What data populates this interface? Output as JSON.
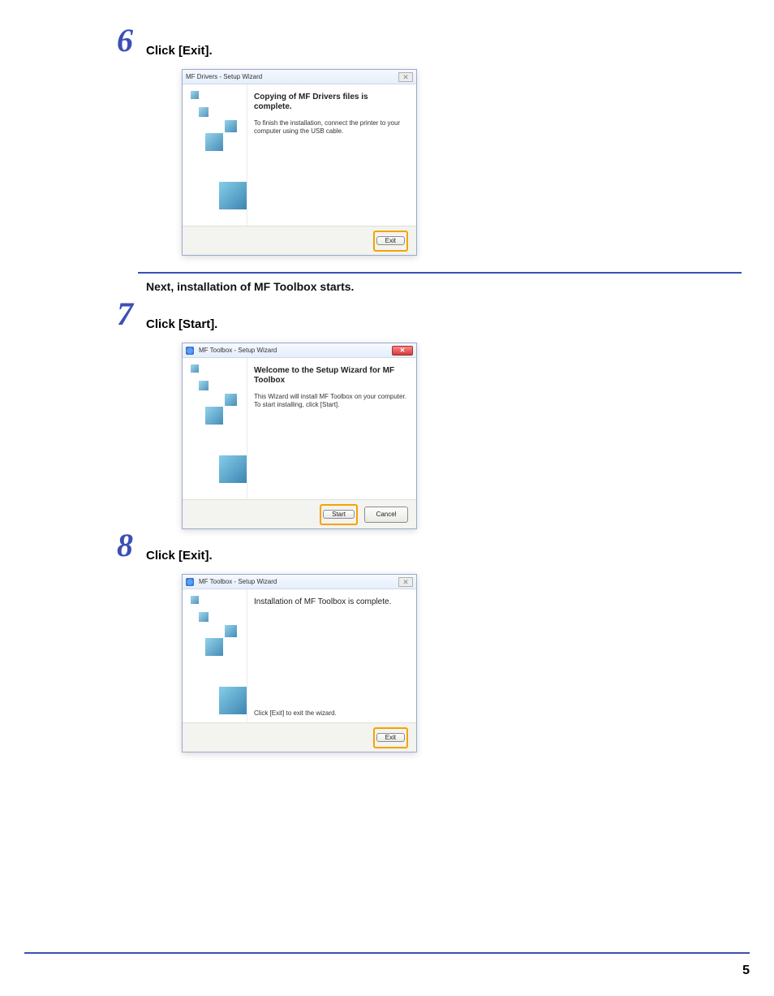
{
  "page_number": "5",
  "steps": [
    {
      "num": "6",
      "title": "Click [Exit].",
      "dialog": {
        "title": "MF Drivers - Setup Wizard",
        "close_style": "grey",
        "close_glyph": "✕",
        "heading": "Copying of MF Drivers files is complete.",
        "body": "To finish the installation, connect the printer to your computer using the USB cable.",
        "buttons": [
          {
            "label": "Exit",
            "highlight": true
          }
        ]
      }
    }
  ],
  "intertext": "Next, installation of MF Toolbox starts.",
  "steps2": [
    {
      "num": "7",
      "title": "Click [Start].",
      "dialog": {
        "title": "MF Toolbox - Setup Wizard",
        "close_style": "red",
        "close_glyph": "✕",
        "heading": "Welcome to the Setup Wizard for MF Toolbox",
        "body": "This Wizard will install MF Toolbox on your computer. To start installing, click [Start].",
        "buttons": [
          {
            "label": "Start",
            "highlight": true
          },
          {
            "label": "Cancel",
            "highlight": false
          }
        ]
      }
    },
    {
      "num": "8",
      "title": "Click [Exit].",
      "dialog": {
        "title": "MF Toolbox - Setup Wizard",
        "close_style": "grey",
        "close_glyph": "✕",
        "heading": "Installation of MF Toolbox is complete.",
        "body": "",
        "bottom_text": "Click [Exit] to exit the wizard.",
        "buttons": [
          {
            "label": "Exit",
            "highlight": true
          }
        ]
      }
    }
  ]
}
